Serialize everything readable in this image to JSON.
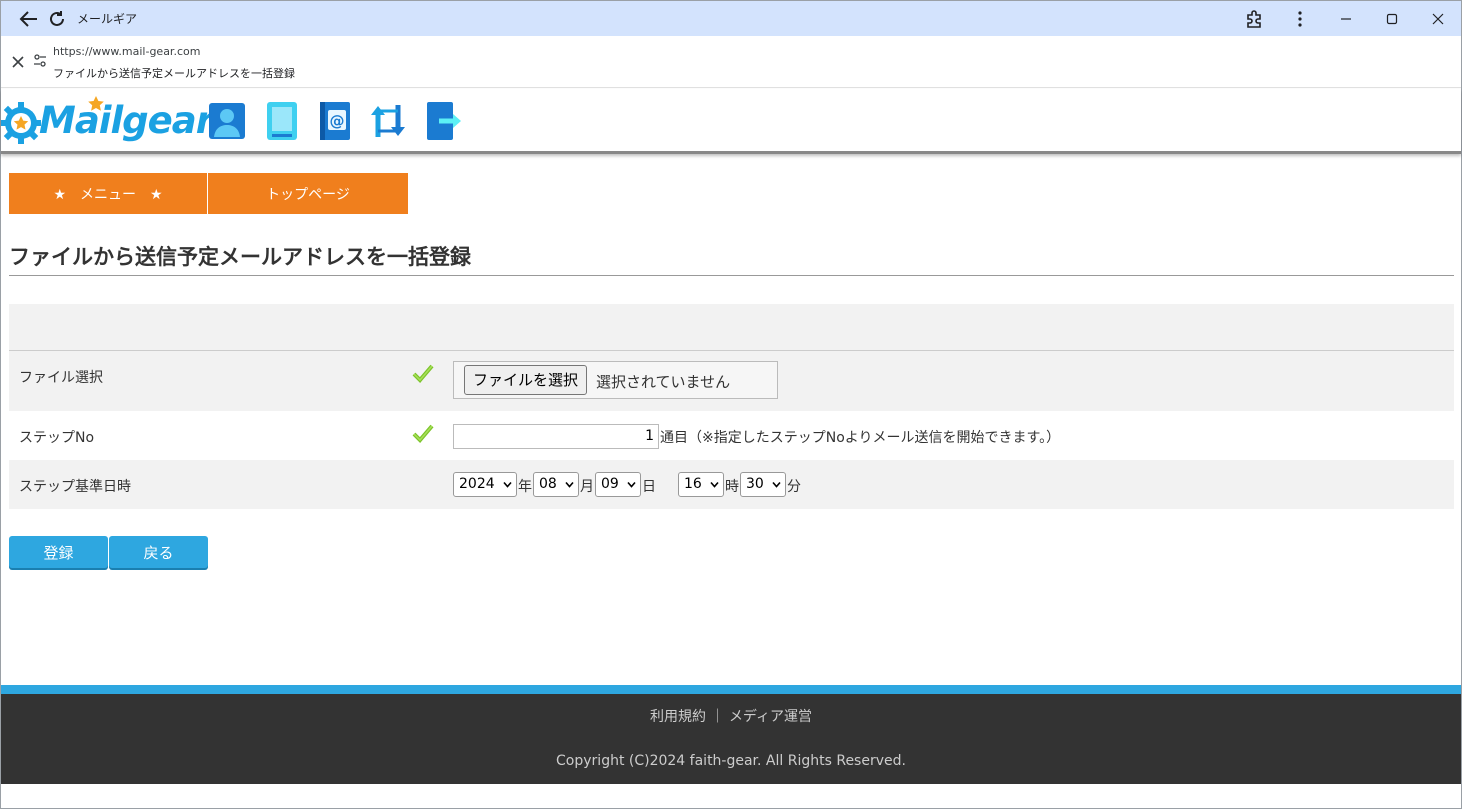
{
  "browser": {
    "app_title": "メールギア",
    "url": "https://www.mail-gear.com",
    "page_title": "ファイルから送信予定メールアドレスを一括登録"
  },
  "site": {
    "logo_text": "Mailgear",
    "header_icons": [
      "user-icon",
      "book-icon",
      "address-book-icon",
      "sync-icon",
      "logout-icon"
    ]
  },
  "menu": {
    "tabs": [
      {
        "label": "★　メニュー　★"
      },
      {
        "label": "トップページ"
      }
    ]
  },
  "main": {
    "heading": "ファイルから送信予定メールアドレスを一括登録",
    "rows": {
      "file": {
        "label": "ファイル選択",
        "button": "ファイルを選択",
        "status": "選択されていません"
      },
      "step": {
        "label": "ステップNo",
        "value": "1",
        "note": "通目（※指定したステップNoよりメール送信を開始できます。）"
      },
      "datetime": {
        "label": "ステップ基準日時",
        "year": "2024",
        "year_unit": "年",
        "month": "08",
        "month_unit": "月",
        "day": "09",
        "day_unit": "日",
        "hour": "16",
        "hour_unit": "時",
        "minute": "30",
        "minute_unit": "分"
      }
    },
    "buttons": {
      "register": "登録",
      "back": "戻る"
    }
  },
  "footer": {
    "terms": "利用規約",
    "separator": "｜",
    "media": "メディア運営",
    "copyright": "Copyright (C)2024 faith-gear. All Rights Reserved."
  },
  "colors": {
    "tab_orange": "#f07f1d",
    "button_blue": "#2ea7e0",
    "footer_dark": "#333333",
    "check_green": "#7cc42a",
    "titlebar_blue": "#d3e3fd"
  }
}
